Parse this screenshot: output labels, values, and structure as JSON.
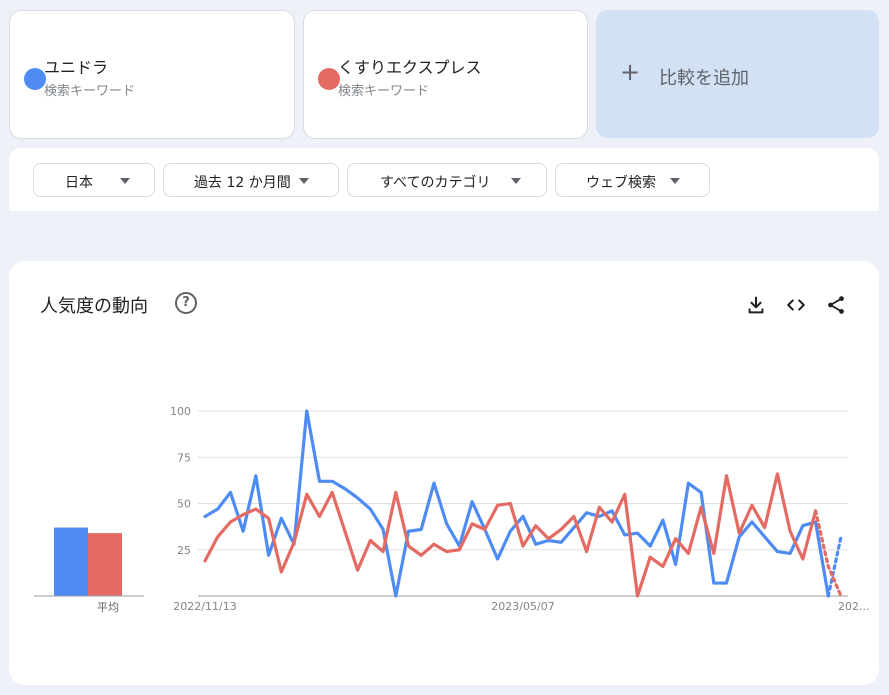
{
  "terms": [
    {
      "name": "ユニドラ",
      "sub": "検索キーワード",
      "color": "#4e8cf3"
    },
    {
      "name": "くすりエクスプレス",
      "sub": "検索キーワード",
      "color": "#e46b63"
    }
  ],
  "add": {
    "plus": "+",
    "label": "比較を追加"
  },
  "filters": [
    {
      "label": "日本"
    },
    {
      "label": "過去 12 か月間"
    },
    {
      "label": "すべてのカテゴリ"
    },
    {
      "label": "ウェブ検索"
    }
  ],
  "trend": {
    "title": "人気度の動向",
    "help": "?",
    "avg_label": "平均",
    "icons": [
      "download-icon",
      "embed-icon",
      "share-icon"
    ]
  },
  "chart_data": {
    "type": "line",
    "ylim": [
      0,
      100
    ],
    "yticks": [
      25,
      50,
      75,
      100
    ],
    "xtick_labels": [
      {
        "label": "2022/11/13",
        "index": 0
      },
      {
        "label": "2023/05/07",
        "index": 25
      },
      {
        "label": "202...",
        "index": 51
      }
    ],
    "series": [
      {
        "name": "ユニドラ",
        "color": "#4e8cf3",
        "average": 37,
        "values": [
          43,
          47,
          56,
          35,
          65,
          22,
          42,
          28,
          100,
          62,
          62,
          58,
          53,
          47,
          36,
          0,
          35,
          36,
          61,
          39,
          27,
          51,
          36,
          20,
          35,
          43,
          28,
          30,
          29,
          37,
          45,
          43,
          46,
          33,
          34,
          27,
          41,
          17,
          61,
          56,
          7,
          7,
          32,
          40,
          32,
          24,
          23,
          38,
          40,
          0,
          32
        ],
        "partial_from": 49
      },
      {
        "name": "くすりエクスプレス",
        "color": "#e46b63",
        "average": 34,
        "values": [
          19,
          32,
          40,
          44,
          47,
          42,
          13,
          29,
          55,
          43,
          56,
          35,
          14,
          30,
          24,
          56,
          27,
          22,
          28,
          24,
          25,
          39,
          36,
          49,
          50,
          27,
          38,
          31,
          36,
          43,
          24,
          48,
          40,
          55,
          0,
          21,
          16,
          31,
          23,
          48,
          23,
          65,
          34,
          49,
          37,
          66,
          35,
          20,
          46,
          16,
          0
        ],
        "partial_from": 48
      }
    ]
  }
}
